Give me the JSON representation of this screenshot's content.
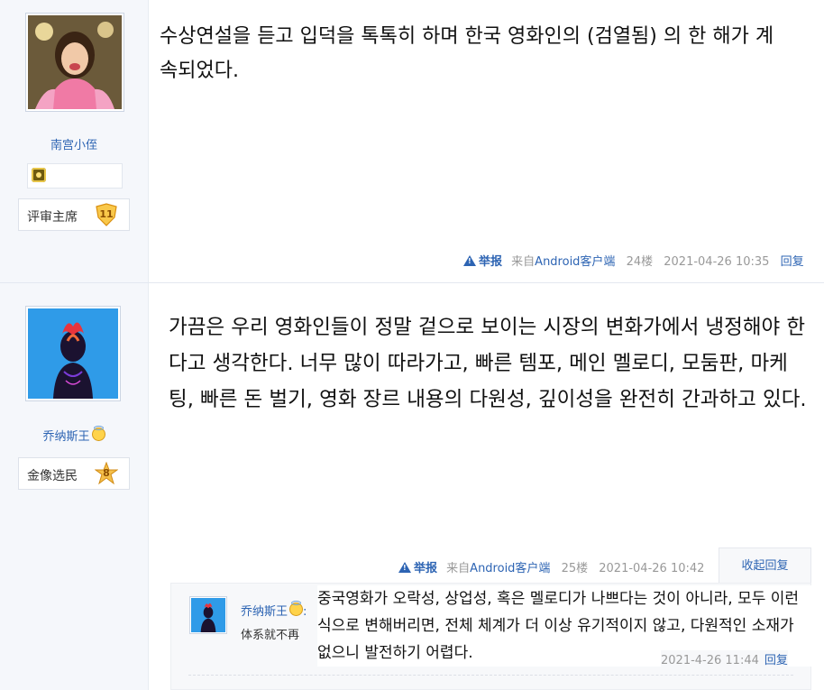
{
  "posts": [
    {
      "username": "南宫小侄",
      "rank_label": "评审主席",
      "rank_level": "11",
      "content": "수상연설을 듣고 입덕을 톡톡히 하며 한국 영화인의 (검열됨) 의 한 해가 계속되었다.",
      "report_label": "举报",
      "client_prefix": "来自",
      "client_name": "Android客户端",
      "floor": "24楼",
      "time": "2021-04-26 10:35",
      "reply_label": "回复"
    },
    {
      "username": "乔纳斯王",
      "rank_label": "金像选民",
      "rank_level": "8",
      "content": "가끔은 우리 영화인들이 정말 겉으로 보이는 시장의 변화가에서 냉정해야 한다고 생각한다. 너무 많이 따라가고, 빠른 템포, 메인 멜로디, 모둠판, 마케팅, 빠른 돈 벌기, 영화 장르 내용의 다원성, 깊이성을 완전히 간과하고 있다.",
      "report_label": "举报",
      "client_prefix": "来自",
      "client_name": "Android客户端",
      "floor": "25楼",
      "time": "2021-04-26 10:42",
      "collapse_label": "收起回复"
    }
  ],
  "sub_reply": {
    "username": "乔纳斯王",
    "username_suffix": ":",
    "text_behind": "体系就不再",
    "overlay_text": "중국영화가 오락성, 상업성, 혹은 멜로디가 나쁘다는 것이 아니라, 모두 이런 식으로 변해버리면, 전체 체계가 더 이상 유기적이지 않고, 다원적인 소재가 없으니 발전하기 어렵다.",
    "time": "2021-4-26 11:44",
    "reply_label": "回复"
  },
  "colors": {
    "link": "#2d64b3",
    "meta": "#999999",
    "sidebar_bg": "#f5f7fb"
  }
}
